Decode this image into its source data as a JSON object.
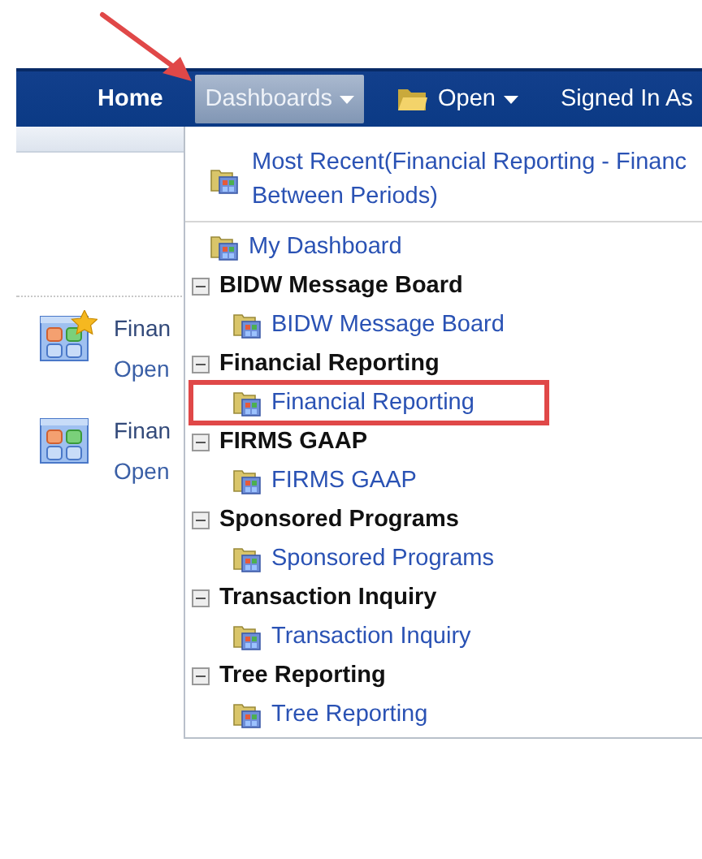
{
  "nav": {
    "items": [
      {
        "kind": "link",
        "label": "Home",
        "selected": false
      },
      {
        "kind": "menu",
        "label": "Dashboards",
        "selected": true
      },
      {
        "kind": "folder-menu",
        "label": "Open",
        "selected": false
      },
      {
        "kind": "text",
        "label": "Signed In As",
        "selected": false
      }
    ]
  },
  "favorites": [
    {
      "title": "Finan",
      "link": "Open",
      "starred": true
    },
    {
      "title": "Finan",
      "link": "Open",
      "starred": false
    }
  ],
  "dashboards_menu": {
    "recent": {
      "lines": [
        "Most Recent(Financial Reporting - Financ",
        "Between Periods)"
      ]
    },
    "items": [
      {
        "kind": "dashboard",
        "label": "My Dashboard"
      },
      {
        "kind": "group",
        "label": "BIDW Message Board",
        "expanded": true,
        "children": [
          {
            "label": "BIDW Message Board",
            "highlighted": false
          }
        ]
      },
      {
        "kind": "group",
        "label": "Financial Reporting",
        "expanded": true,
        "children": [
          {
            "label": "Financial Reporting",
            "highlighted": true
          }
        ]
      },
      {
        "kind": "group",
        "label": "FIRMS GAAP",
        "expanded": true,
        "children": [
          {
            "label": "FIRMS GAAP",
            "highlighted": false
          }
        ]
      },
      {
        "kind": "group",
        "label": "Sponsored Programs",
        "expanded": true,
        "children": [
          {
            "label": "Sponsored Programs",
            "highlighted": false
          }
        ]
      },
      {
        "kind": "group",
        "label": "Transaction Inquiry",
        "expanded": true,
        "children": [
          {
            "label": "Transaction Inquiry",
            "highlighted": false
          }
        ]
      },
      {
        "kind": "group",
        "label": "Tree Reporting",
        "expanded": true,
        "children": [
          {
            "label": "Tree Reporting",
            "highlighted": false
          }
        ]
      }
    ]
  }
}
